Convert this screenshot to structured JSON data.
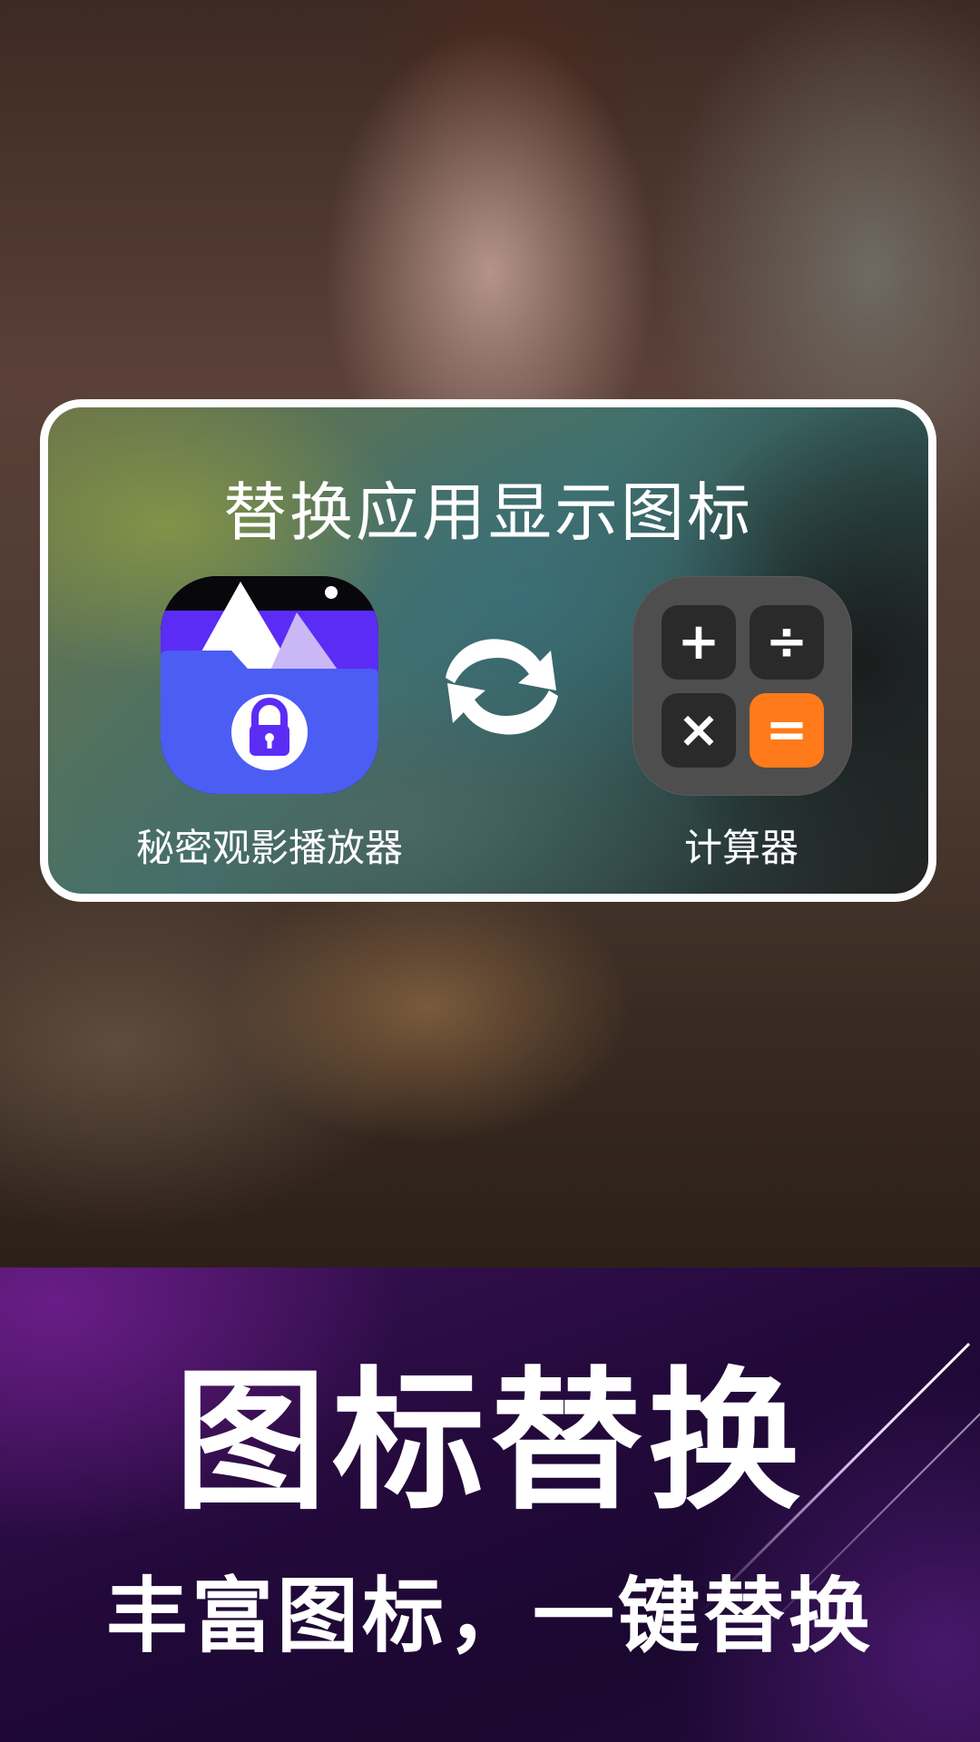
{
  "card": {
    "title": "替换应用显示图标",
    "apps": [
      {
        "label": "秘密观影播放器",
        "icon": "lock-folder-gallery-icon"
      },
      {
        "label": "计算器",
        "icon": "calculator-icon"
      }
    ],
    "swap_icon": "swap-arrows-icon",
    "calculator_keys": [
      "+",
      "÷",
      "×",
      "="
    ]
  },
  "promo": {
    "title": "图标替换",
    "subtitle": "丰富图标，一键替换"
  },
  "colors": {
    "vault_purple": "#5b3cf0",
    "vault_blue": "#4a5cf5",
    "calc_orange": "#ff7a1a",
    "promo_purple": "#22093a"
  }
}
